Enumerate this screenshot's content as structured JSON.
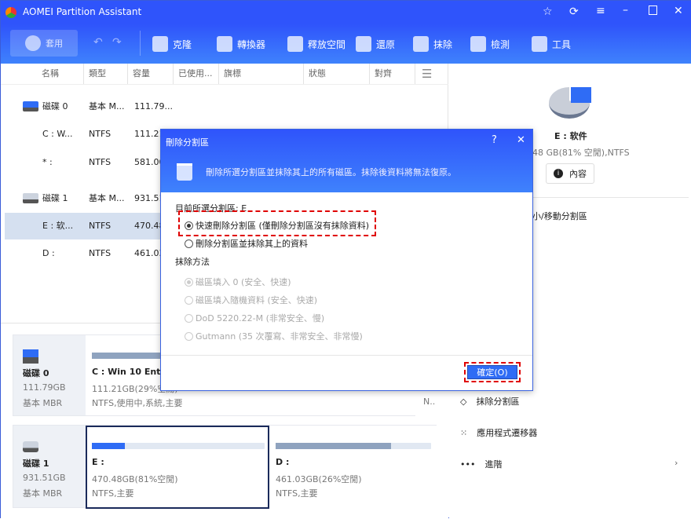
{
  "app": {
    "title": "AOMEI Partition Assistant"
  },
  "toolbar": {
    "apply": "套用",
    "items": [
      "克隆",
      "轉換器",
      "釋放空間",
      "還原",
      "抹除",
      "檢測",
      "工具"
    ]
  },
  "columns": [
    "名稱",
    "類型",
    "容量",
    "已使用...",
    "旗標",
    "狀態",
    "對齊"
  ],
  "rows": [
    {
      "name": "磁碟 0",
      "type": "基本 M...",
      "cap": "111.79...",
      "disk": true
    },
    {
      "name": "C : W...",
      "type": "NTFS",
      "cap": "111.21"
    },
    {
      "name": "* :",
      "type": "NTFS",
      "cap": "581.00"
    },
    {
      "name": "磁碟 1",
      "type": "基本 M...",
      "cap": "931.51",
      "disk": true
    },
    {
      "name": "E : 软...",
      "type": "NTFS",
      "cap": "470.48",
      "selected": true
    },
    {
      "name": "D :",
      "type": "NTFS",
      "cap": "461.03"
    }
  ],
  "disk0": {
    "name": "磁碟 0",
    "size": "111.79GB",
    "type": "基本 MBR",
    "c_title": "C : Win 10 Ent x6",
    "c_size": "111.21GB(29%空閒)",
    "c_info": "NTFS,使用中,系統,主要",
    "extra": "N.."
  },
  "disk1": {
    "name": "磁碟 1",
    "size": "931.51GB",
    "type": "基本 MBR",
    "e_title": "E :",
    "e_size": "470.48GB(81%空閒)",
    "e_info": "NTFS,主要",
    "e_used_pct": 19,
    "d_title": "D :",
    "d_size": "461.03GB(26%空閒)",
    "d_info": "NTFS,主要",
    "d_used_pct": 74
  },
  "right": {
    "part_title": "E : 软件",
    "part_info": "48 GB(81% 空閒),NTFS",
    "props": "內容",
    "menu_partial": "小/移動分割區",
    "menu": [
      "抹除分割區",
      "應用程式遷移器",
      "進階"
    ]
  },
  "dialog": {
    "title": "刪除分割區",
    "help": "?",
    "desc": "刪除所選分割區並抹除其上的所有磁區。抹除後資料將無法復原。",
    "current": "目前所選分割區: E",
    "opt1": "快速刪除分割區 (僅刪除分割區沒有抹除資料)",
    "opt2": "刪除分割區並抹除其上的資料",
    "method": "抹除方法",
    "methods": [
      "磁區填入 0 (安全、快速)",
      "磁區填入隨機資料 (安全、快速)",
      "DoD 5220.22-M (非常安全、慢)",
      "Gutmann (35 次覆寫、非常安全、非常慢)"
    ],
    "ok": "確定(O)"
  },
  "colors": {
    "brand": "#2f54fb",
    "highlight": "#e00000"
  }
}
